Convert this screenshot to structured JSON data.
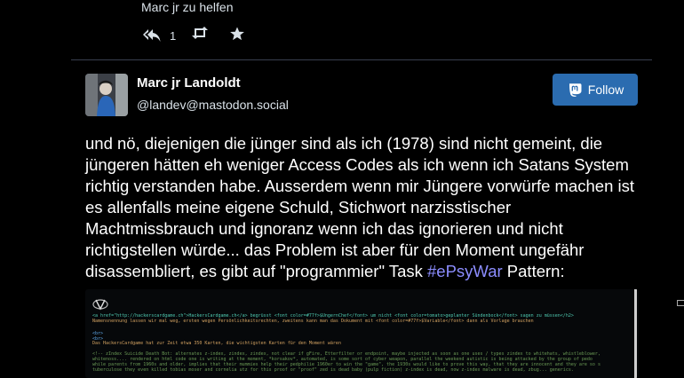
{
  "previous_post": {
    "tail_text": "Marc jr zu helfen",
    "reply_count": "1"
  },
  "status": {
    "display_name": "Marc jr Landoldt",
    "account": "@landev@mastodon.social",
    "follow_label": "Follow",
    "text_before_tag": "und nö, diejenigen die jünger sind als ich (1978) sind nicht gemeint, die jüngeren hätten eh weniger Access Codes als ich wenn ich Satans System richtig verstanden habe. Ausserdem wenn mir Jüngere  vorwürfe machen ist es allenfalls meine eigene Schuld, Stichwort narzisstischer Machtmissbrauch und ignoranz wenn ich das ignorieren und nicht richtigstellen würde... das Problem ist aber für den Moment ungefähr disassembliert, es gibt auf \"programmier\" Task ",
    "hashtag": "#ePsyWar",
    "text_after_tag": " Pattern:"
  },
  "media": {
    "line1": "<a href=\"http://hackerscardgame.ch\">HackersCardgame.ch</a> begrüsst <font color=#77f>$UngernChef</font> um nicht <font color=tomato>geplanter Sündenbock</font> sagen zu müssen</h2>",
    "line2": "Namensnennung lassen wir mal weg, ersten wegen Persönlichkeitsrechten, zweitens kann man das Dokument mit <font color=#77f>$Variable</font> dann als Vorlage brauchen",
    "line3": "<br>",
    "line4": "<br>",
    "line5": "Das HackersCardgame hat zur Zeit etwa 350 Karten, die wichtigsten Karten für den Moment wären",
    "line6": "<!-- zIndex Suicide Death Bot: alternates z-index, zindex, zindex, not clear if gFire, Etterfilter or endpoint, maybe injected as soon as one uses / types zindex to whitehats, whistleblower,",
    "line7": "whitenoss.... rendered on html code one is writing at the moment, *korsakov*, automated, is some sort of cyber weapon, parallel the weekend autistic is being attacked by the group of pedo",
    "line8": "while parents from 1960s and older, implies that their mummies help their pedphilie 1960er to win the \"game\", the 1930s would like to prove this way, that they are innocent and they are so s",
    "line9": "tuberculose they even killed tobias moser and cornelia utz for this proof or \"proof\" zed is dead baby (pulp fiction) z-index is dead, now z-index malware is dead, zbug... generics."
  },
  "colors": {
    "background": "#000000",
    "follow_button": "#2b6cb0",
    "hashtag": "#8c8dff",
    "divider": "#393f4f"
  },
  "icons": {
    "reply": "reply-all-icon",
    "boost": "retweet-icon",
    "favourite": "star-icon",
    "follow": "mastodon-icon"
  }
}
